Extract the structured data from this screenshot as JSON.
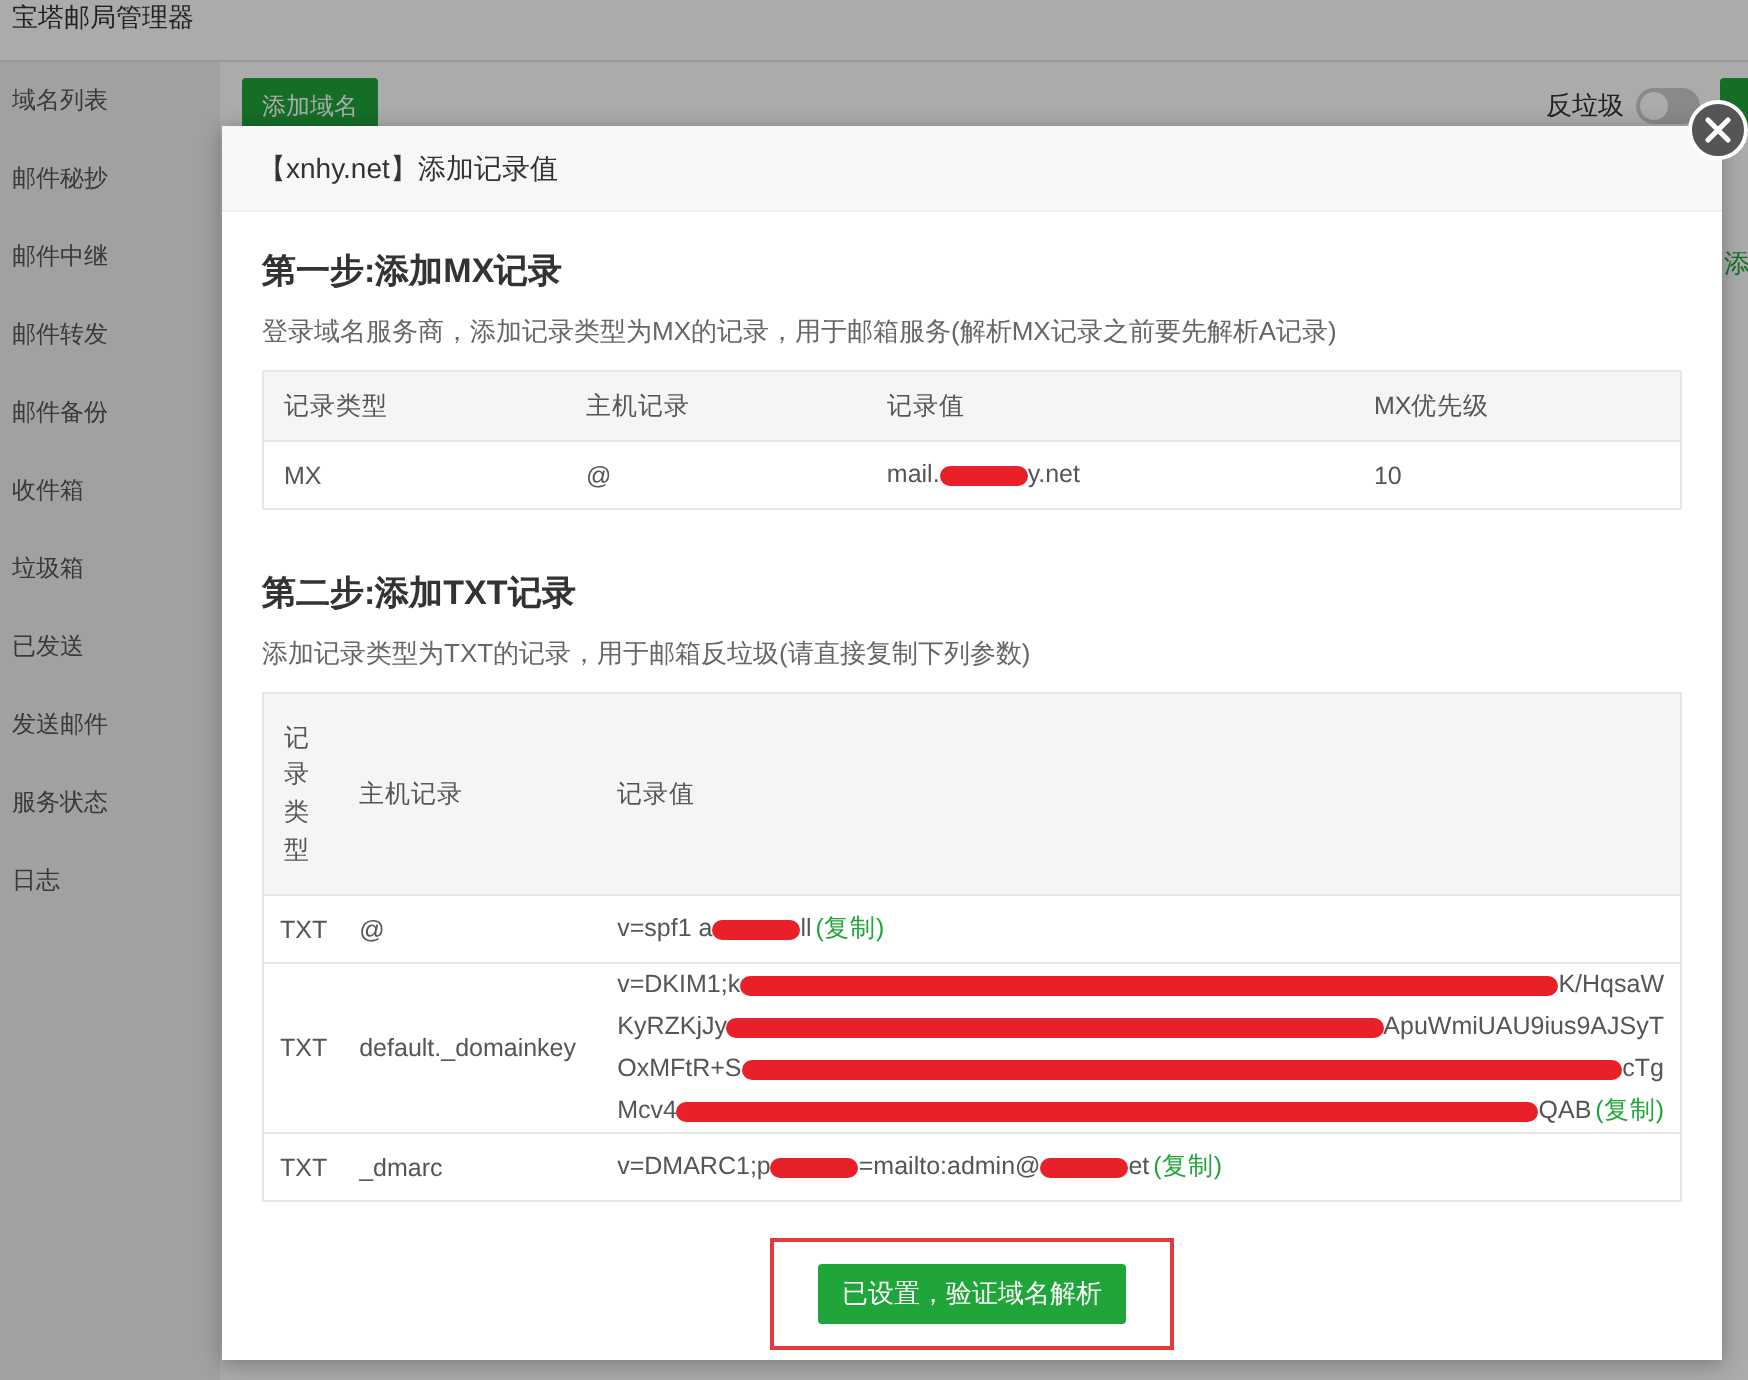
{
  "app": {
    "title": "宝塔邮局管理器"
  },
  "sidebar": {
    "items": [
      {
        "label": "域名列表"
      },
      {
        "label": "邮件秘抄"
      },
      {
        "label": "邮件中继"
      },
      {
        "label": "邮件转发"
      },
      {
        "label": "邮件备份"
      },
      {
        "label": "收件箱"
      },
      {
        "label": "垃圾箱"
      },
      {
        "label": "已发送"
      },
      {
        "label": "发送邮件"
      },
      {
        "label": "服务状态"
      },
      {
        "label": "日志"
      }
    ]
  },
  "toolbar": {
    "add_button": "添加域名",
    "spam_toggle": {
      "label": "反垃圾",
      "on": false
    },
    "edge_text": "添"
  },
  "dialog": {
    "title": "【xnhy.net】添加记录值",
    "mx_step": {
      "heading": "第一步:添加MX记录",
      "description": "登录域名服务商，添加记录类型为MX的记录，用于邮箱服务(解析MX记录之前要先解析A记录)",
      "columns": [
        "记录类型",
        "主机记录",
        "记录值",
        "MX优先级"
      ],
      "rows": [
        {
          "type": "MX",
          "host": "@",
          "value_lines": [
            [
              {
                "kind": "text",
                "text": "mail."
              },
              {
                "kind": "redacted"
              },
              {
                "kind": "text",
                "text": "y.net"
              }
            ]
          ],
          "priority": "10"
        }
      ]
    },
    "txt_step": {
      "heading": "第二步:添加TXT记录",
      "description": "添加记录类型为TXT的记录，用于邮箱反垃圾(请直接复制下列参数)",
      "columns": [
        "记录类型",
        "主机记录",
        "记录值"
      ],
      "rows": [
        {
          "type": "TXT",
          "host": "@",
          "value_lines": [
            [
              {
                "kind": "text",
                "text": "v=spf1 a"
              },
              {
                "kind": "redacted"
              },
              {
                "kind": "text",
                "text": "ll"
              },
              {
                "kind": "copy_link",
                "text": "(复制)"
              }
            ]
          ]
        },
        {
          "type": "TXT",
          "host": "default._domainkey",
          "value_lines": [
            [
              {
                "kind": "text",
                "text": "v=DKIM1;k"
              },
              {
                "kind": "redacted"
              },
              {
                "kind": "text",
                "text": "K/HqsaW"
              }
            ],
            [
              {
                "kind": "text",
                "text": "KyRZKjJy"
              },
              {
                "kind": "redacted"
              },
              {
                "kind": "text",
                "text": "ApuWmiUAU9ius9AJSyT"
              }
            ],
            [
              {
                "kind": "text",
                "text": "OxMFtR+S"
              },
              {
                "kind": "redacted"
              },
              {
                "kind": "text",
                "text": "cTg"
              }
            ],
            [
              {
                "kind": "text",
                "text": "Mcv4"
              },
              {
                "kind": "redacted"
              },
              {
                "kind": "text",
                "text": "QAB"
              },
              {
                "kind": "copy_link",
                "text": "(复制)"
              }
            ]
          ]
        },
        {
          "type": "TXT",
          "host": "_dmarc",
          "value_lines": [
            [
              {
                "kind": "text",
                "text": "v=DMARC1;p"
              },
              {
                "kind": "redacted"
              },
              {
                "kind": "text",
                "text": "=mailto:admin@"
              },
              {
                "kind": "redacted"
              },
              {
                "kind": "text",
                "text": "et"
              },
              {
                "kind": "copy_link",
                "text": "(复制)"
              }
            ]
          ]
        }
      ]
    },
    "confirm_button": "已设置，验证域名解析"
  }
}
